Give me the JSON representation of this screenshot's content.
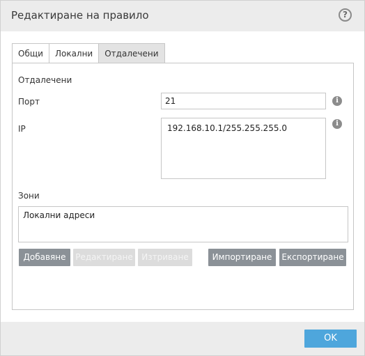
{
  "dialog": {
    "title": "Редактиране на правило",
    "help_icon": "question-mark-icon"
  },
  "tabs": [
    {
      "label": "Общи",
      "active": false
    },
    {
      "label": "Локални",
      "active": false
    },
    {
      "label": "Отдалечени",
      "active": true
    }
  ],
  "remote": {
    "section_title": "Отдалечени",
    "port_label": "Порт",
    "port_value": "21",
    "ip_label": "IP",
    "ip_value": "192.168.10.1/255.255.255.0",
    "info_icon": "info-icon"
  },
  "zones": {
    "label": "Зони",
    "items": [
      "Локални адреси"
    ]
  },
  "buttons": {
    "add": "Добавяне",
    "edit": "Редактиране",
    "delete": "Изтриване",
    "import": "Импортиране",
    "export": "Експортиране"
  },
  "footer": {
    "ok": "OK"
  },
  "colors": {
    "accent": "#4ea6dc",
    "button": "#8b9197",
    "button_disabled": "#dcdcdc"
  }
}
